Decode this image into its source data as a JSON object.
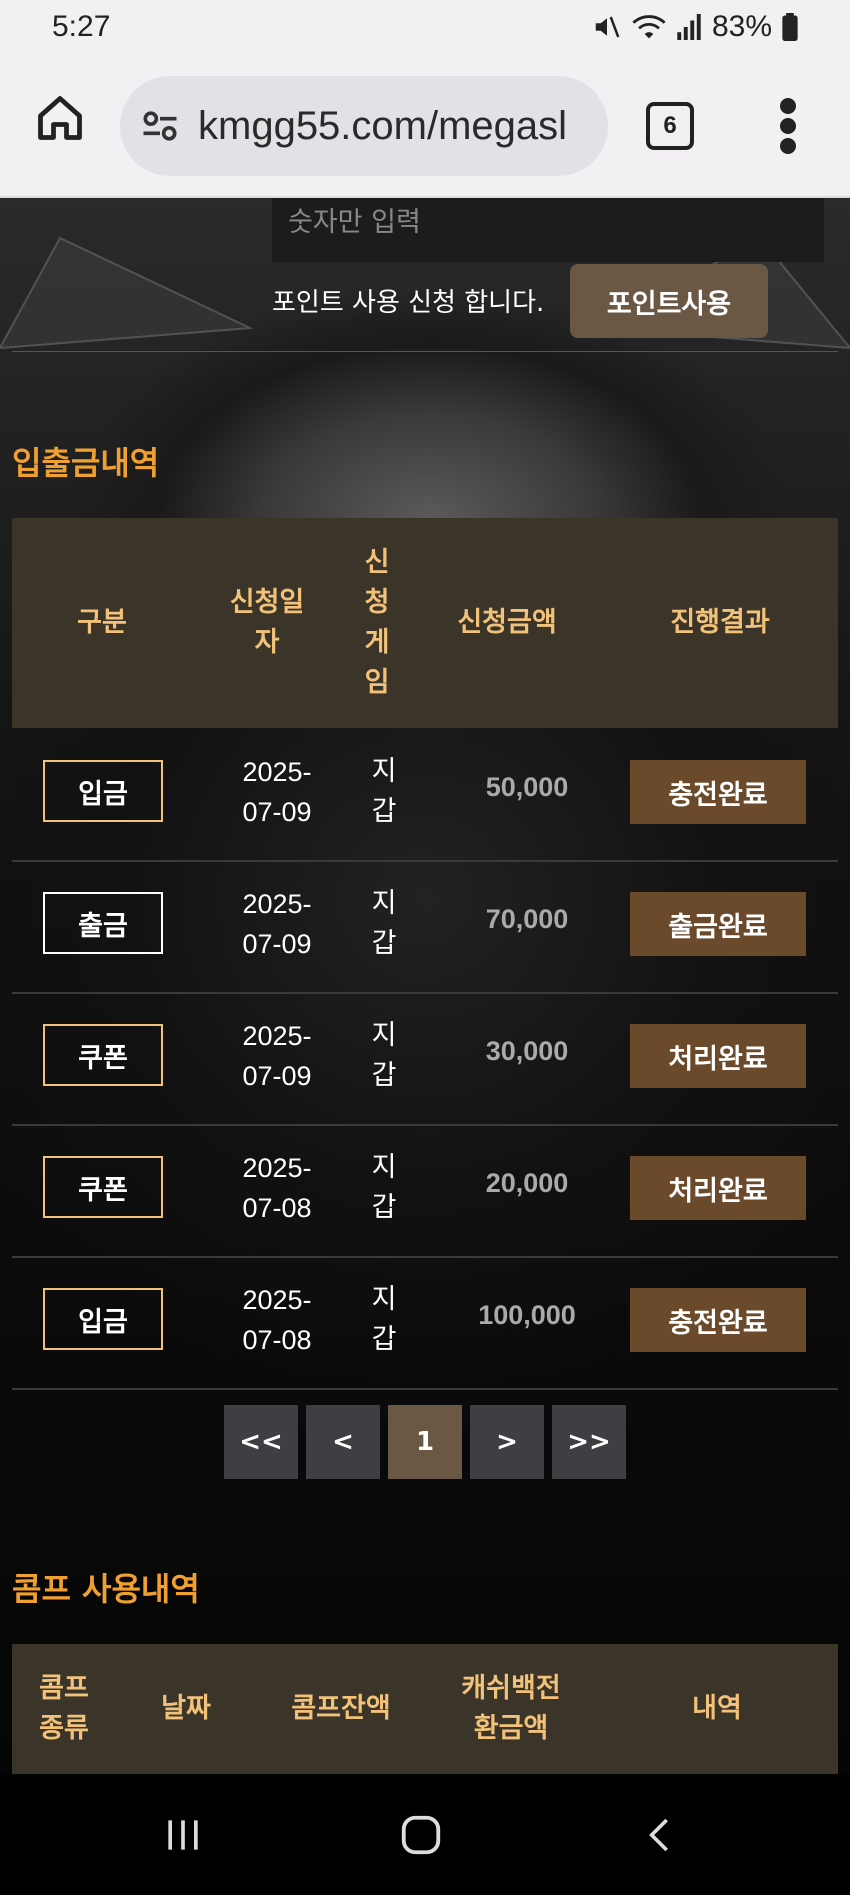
{
  "status_bar": {
    "time": "5:27",
    "battery": "83%"
  },
  "browser": {
    "url": "kmgg55.com/megasl",
    "tab_count": "6"
  },
  "point": {
    "input_placeholder": "숫자만 입력",
    "apply_text": "포인트 사용 신청 합니다.",
    "use_button": "포인트사용"
  },
  "history": {
    "title": "입출금내역",
    "headers": [
      "구분",
      "신청일\n자",
      "신\n청\n게\n임",
      "신청금액",
      "진행결과"
    ],
    "rows": [
      {
        "type": "입금",
        "date": "2025-\n07-09",
        "game": "지\n갑",
        "amount": "50,000",
        "status": "충전완료"
      },
      {
        "type": "출금",
        "date": "2025-\n07-09",
        "game": "지\n갑",
        "amount": "70,000",
        "status": "출금완료"
      },
      {
        "type": "쿠폰",
        "date": "2025-\n07-09",
        "game": "지\n갑",
        "amount": "30,000",
        "status": "처리완료"
      },
      {
        "type": "쿠폰",
        "date": "2025-\n07-08",
        "game": "지\n갑",
        "amount": "20,000",
        "status": "처리완료"
      },
      {
        "type": "입금",
        "date": "2025-\n07-08",
        "game": "지\n갑",
        "amount": "100,000",
        "status": "충전완료"
      }
    ]
  },
  "pagination": {
    "first": "<<",
    "prev": "<",
    "current": "1",
    "next": ">",
    "last": ">>"
  },
  "comp": {
    "title": "콤프 사용내역",
    "headers": [
      "콤프\n종류",
      "날짜",
      "콤프잔액",
      "캐쉬백전\n환금액",
      "내역"
    ]
  }
}
